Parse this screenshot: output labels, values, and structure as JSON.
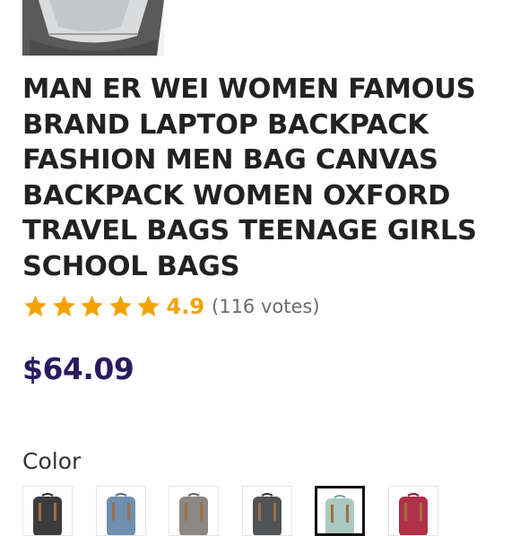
{
  "product": {
    "title": "MAN ER WEI WOMEN FAMOUS BRAND LAPTOP BACKPACK FASHION MEN BAG CANVAS BACKPACK WOMEN OXFORD TRAVEL BAGS TEENAGE GIRLS SCHOOL BAGS",
    "image_icon": "backpack-photo"
  },
  "rating": {
    "stars_filled": 5,
    "stars_total": 5,
    "value": "4.9",
    "votes": "(116 votes)",
    "star_color": "#f5a100"
  },
  "price": {
    "text": "$64.09",
    "color": "#2a1a5e"
  },
  "color": {
    "label": "Color",
    "swatches": [
      {
        "icon": "backpack-black",
        "color": "#3c3c3c",
        "selected": false
      },
      {
        "icon": "backpack-blue",
        "color": "#6f8fae",
        "selected": false
      },
      {
        "icon": "backpack-gray",
        "color": "#8a8784",
        "selected": false
      },
      {
        "icon": "backpack-dark-gray",
        "color": "#505357",
        "selected": false
      },
      {
        "icon": "backpack-mint",
        "color": "#a9c9c1",
        "selected": true
      },
      {
        "icon": "backpack-red",
        "color": "#b03048",
        "selected": false
      }
    ]
  }
}
